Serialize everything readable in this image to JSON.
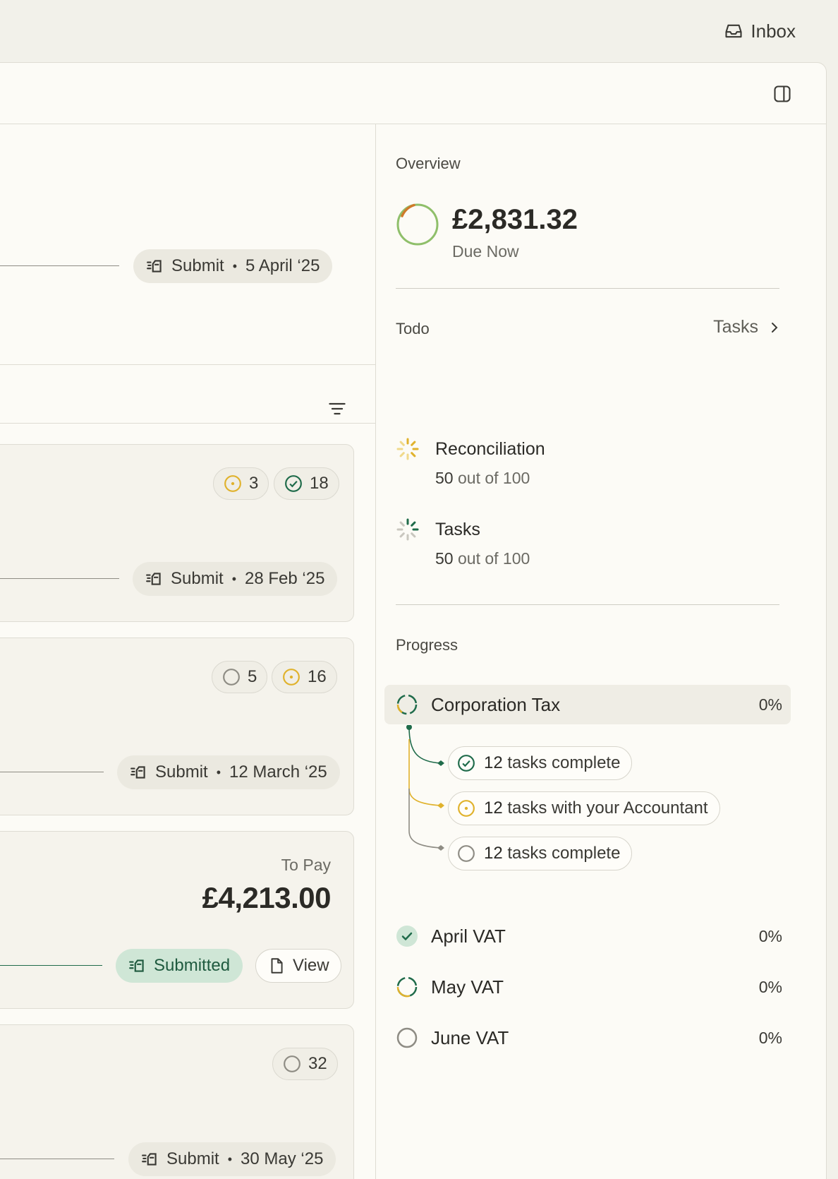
{
  "topbar": {
    "inbox_label": "Inbox"
  },
  "left": {
    "top_submit": {
      "label": "Submit",
      "date": "5 April ‘25"
    },
    "cards": [
      {
        "badges": [
          {
            "icon": "pending-dot-icon",
            "count": "3"
          },
          {
            "icon": "check-circle-icon",
            "count": "18"
          }
        ],
        "submit_label": "Submit",
        "date": "28 Feb ‘25"
      },
      {
        "badges": [
          {
            "icon": "empty-circle-icon",
            "count": "5"
          },
          {
            "icon": "pending-dot-icon",
            "count": "16"
          }
        ],
        "submit_label": "Submit",
        "date": "12 March ‘25"
      },
      {
        "to_pay_label": "To Pay",
        "to_pay_amount": "£4,213.00",
        "submitted_label": "Submitted",
        "view_label": "View"
      },
      {
        "badges": [
          {
            "icon": "empty-circle-icon",
            "count": "32"
          }
        ],
        "submit_label": "Submit",
        "date": "30 May ‘25"
      }
    ]
  },
  "right": {
    "overview": {
      "title": "Overview",
      "amount": "£2,831.32",
      "sub": "Due Now"
    },
    "todo": {
      "title": "Todo",
      "link_label": "Tasks",
      "items": [
        {
          "name": "Reconciliation",
          "done": "50",
          "suffix": "out of 100"
        },
        {
          "name": "Tasks",
          "done": "50",
          "suffix": "out of 100"
        }
      ]
    },
    "progress": {
      "title": "Progress",
      "rows": [
        {
          "name": "Corporation Tax",
          "pct": "0%"
        },
        {
          "name": "April VAT",
          "pct": "0%"
        },
        {
          "name": "May VAT",
          "pct": "0%"
        },
        {
          "name": "June VAT",
          "pct": "0%"
        }
      ],
      "subtasks": [
        {
          "num": "12",
          "text": "tasks complete"
        },
        {
          "num": "12",
          "text": "tasks with your Accountant"
        },
        {
          "num": "12",
          "text": "tasks complete"
        }
      ]
    }
  },
  "colors": {
    "green": "#1f6b4a",
    "amber": "#e0b22c",
    "grey": "#8e8c84",
    "submitted_bg": "#cfe6d6"
  }
}
